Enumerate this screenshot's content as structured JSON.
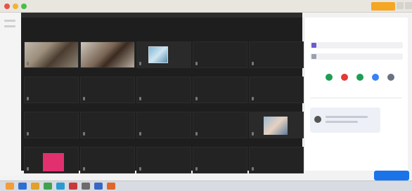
{
  "window": {
    "title": "",
    "accent": "#f5a623",
    "dots": [
      "#e6534b",
      "#f2b233",
      "#4bbd4b"
    ]
  },
  "meeting": {
    "topbar_label": "",
    "tiles": [
      {
        "id": "a1",
        "kind": "video-a",
        "name": "",
        "mic": true
      },
      {
        "id": "a2",
        "kind": "video-b",
        "name": "",
        "mic": false
      },
      {
        "id": "a3",
        "kind": "video-c",
        "name": "",
        "mic": true
      },
      {
        "id": "a4",
        "kind": "name",
        "name": "",
        "mic": true
      },
      {
        "id": "a5",
        "kind": "name",
        "name": "",
        "mic": true
      },
      {
        "id": "b1",
        "kind": "name",
        "name": "",
        "mic": true
      },
      {
        "id": "b2",
        "kind": "name",
        "name": "",
        "mic": true
      },
      {
        "id": "b3",
        "kind": "name",
        "name": "",
        "mic": true
      },
      {
        "id": "b4",
        "kind": "name",
        "name": "",
        "mic": true
      },
      {
        "id": "b5",
        "kind": "name",
        "name": "",
        "mic": true
      },
      {
        "id": "c1",
        "kind": "name",
        "name": "",
        "mic": true
      },
      {
        "id": "c2",
        "kind": "name",
        "name": "",
        "mic": true
      },
      {
        "id": "c3",
        "kind": "name",
        "name": "",
        "mic": true
      },
      {
        "id": "c4",
        "kind": "name",
        "name": "",
        "mic": true
      },
      {
        "id": "c5",
        "kind": "video-d",
        "name": "",
        "mic": true
      },
      {
        "id": "d1",
        "kind": "pink",
        "name": "",
        "mic": true
      },
      {
        "id": "d2",
        "kind": "name",
        "name": "",
        "mic": true
      },
      {
        "id": "d3",
        "kind": "name",
        "name": "",
        "mic": true
      },
      {
        "id": "d4",
        "kind": "name",
        "name": "",
        "mic": true
      },
      {
        "id": "d5",
        "kind": "name",
        "name": "",
        "mic": true
      }
    ]
  },
  "panel": {
    "title": "",
    "subtitle": "",
    "rows": [
      {
        "text": "",
        "end": ""
      },
      {
        "text": "",
        "end": ""
      }
    ],
    "controls": [
      {
        "name": "mic-control",
        "color": "#1f9d55"
      },
      {
        "name": "stop-control",
        "color": "#e53935"
      },
      {
        "name": "video-control",
        "color": "#1f9d55"
      },
      {
        "name": "share-control",
        "color": "#3b82f6"
      },
      {
        "name": "more-control",
        "color": "#6b7280"
      }
    ],
    "control_labels": [
      "",
      ""
    ],
    "center_label": "",
    "footer": [
      "",
      ""
    ]
  },
  "status": {
    "caption": "",
    "status_text": ""
  },
  "join_button": {
    "label": "",
    "color": "#1a73e8"
  },
  "taskbar": {
    "icons": [
      "#f29d38",
      "#2f6fd1",
      "#e2a12b",
      "#3fa34d",
      "#2c9bd1",
      "#c83b3b",
      "#6c6c6c",
      "#3b67c4",
      "#e0662c"
    ]
  }
}
